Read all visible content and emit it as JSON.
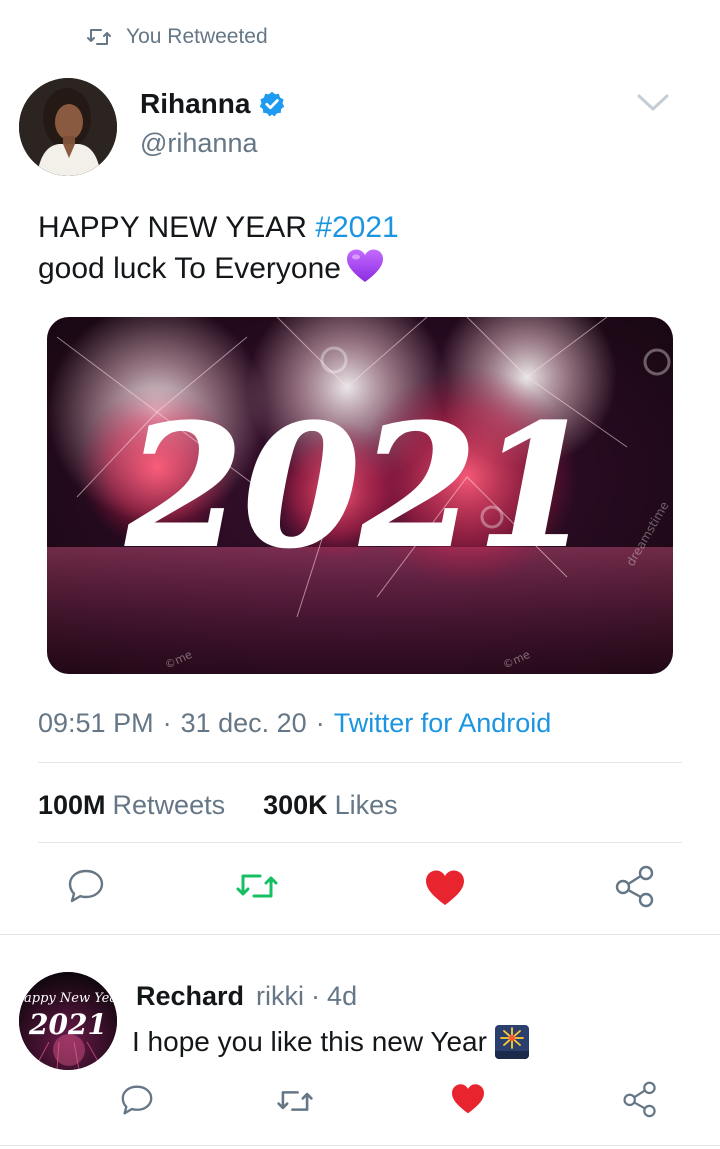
{
  "retweet_context": {
    "label": "You Retweeted"
  },
  "tweet": {
    "author": {
      "name": "Rihanna",
      "handle": "@rihanna",
      "verified": true
    },
    "text_line1": "HAPPY NEW YEAR ",
    "hashtag": "#2021",
    "text_line2": "good luck To Everyone",
    "emoji": "purple-heart",
    "media": {
      "overlay_text": "2021",
      "watermarks": [
        "dreamstime",
        "©me",
        "©me"
      ]
    },
    "time": "09:51 PM",
    "date": "31 dec. 20",
    "source": "Twitter for Android",
    "stats": {
      "retweets_count": "100M",
      "retweets_label": "Retweets",
      "likes_count": "300K",
      "likes_label": "Likes"
    },
    "actions": {
      "reply_icon": "reply-icon",
      "retweet_icon": "retweet-icon",
      "retweet_active": true,
      "like_icon": "heart-icon",
      "like_active": true,
      "share_icon": "share-icon"
    }
  },
  "reply": {
    "author_name": "Rechard",
    "handle": "rikki",
    "separator": "·",
    "time": "4d",
    "text": "I hope you like this new Year",
    "emoji": "fireworks",
    "avatar_text_top": "Happy New Year",
    "avatar_text": "2021"
  },
  "colors": {
    "accent": "#1b95e0",
    "retweet_green": "#17bf63",
    "like_red": "#e0245e",
    "muted": "#657786",
    "divider": "#e1e8ed"
  }
}
